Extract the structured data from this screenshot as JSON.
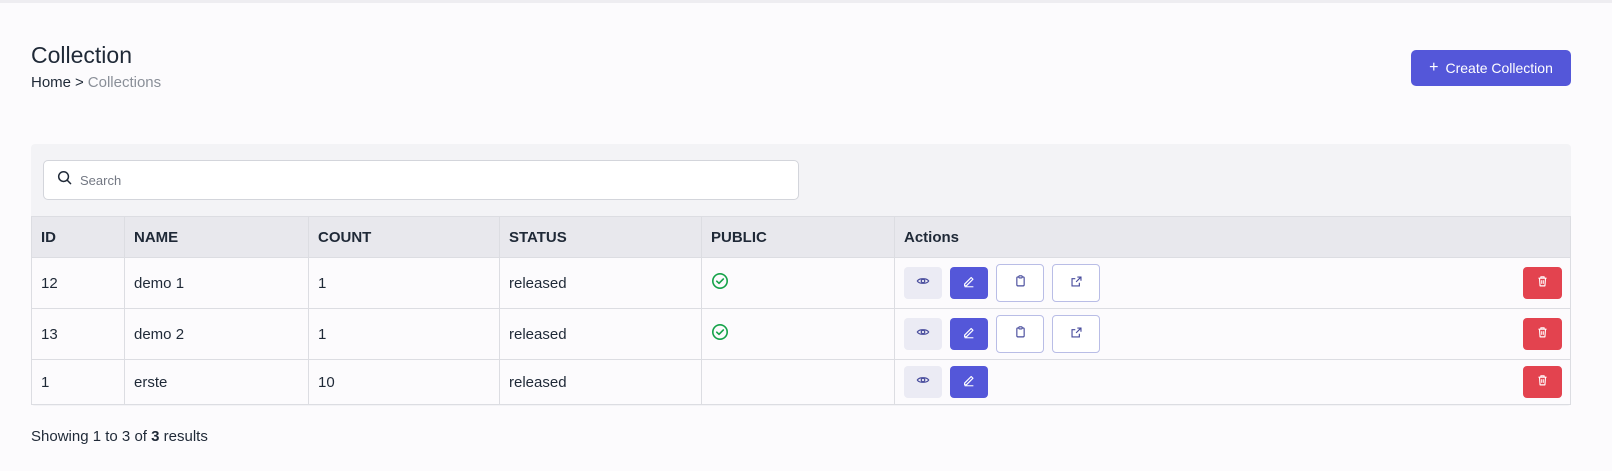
{
  "header": {
    "title": "Collection",
    "breadcrumb": {
      "home": "Home",
      "separator": ">",
      "current": "Collections"
    },
    "create_button": {
      "icon": "plus-icon",
      "label": "Create Collection"
    }
  },
  "search": {
    "placeholder": "Search",
    "value": ""
  },
  "table": {
    "columns": [
      "ID",
      "NAME",
      "COUNT",
      "STATUS",
      "PUBLIC",
      "Actions"
    ],
    "rows": [
      {
        "id": "12",
        "name": "demo 1",
        "count": "1",
        "status": "released",
        "public": true
      },
      {
        "id": "13",
        "name": "demo 2",
        "count": "1",
        "status": "released",
        "public": true
      },
      {
        "id": "1",
        "name": "erste",
        "count": "10",
        "status": "released",
        "public": false
      }
    ]
  },
  "footer": {
    "prefix": "Showing",
    "from": "1",
    "to_word": "to",
    "to": "3",
    "of_word": "of",
    "total": "3",
    "suffix": "results"
  },
  "colors": {
    "accent": "#5457d9",
    "danger": "#e3434f",
    "success": "#16a34a"
  }
}
